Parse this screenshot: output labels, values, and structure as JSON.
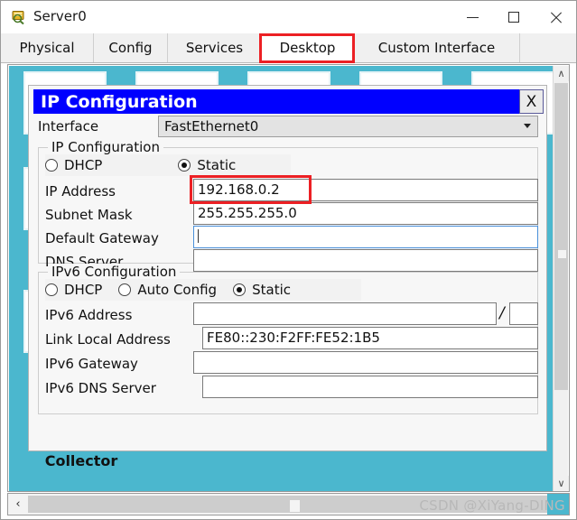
{
  "window": {
    "title": "Server0",
    "icon": "server-magnifier-icon",
    "minimize_label": "–",
    "maximize_label": "□",
    "close_label": "✕"
  },
  "tabs": [
    {
      "label": "Physical",
      "active": false
    },
    {
      "label": "Config",
      "active": false
    },
    {
      "label": "Services",
      "active": false
    },
    {
      "label": "Desktop",
      "active": true
    },
    {
      "label": "Custom Interface",
      "active": false
    }
  ],
  "annotations": {
    "color": "#ec2024",
    "desktop_tab_highlight": "Desktop",
    "ip_address_highlight": "192.168.0.2"
  },
  "desktop": {
    "background_color": "#4bb7ce",
    "partial_caption": "Collector",
    "tiles": [
      {
        "art": "monitor-tilt"
      },
      {
        "art": "monitor-tilt"
      },
      {
        "art": "monitor-flat"
      },
      {
        "art": "monitor-dark"
      },
      {
        "art": "globe"
      }
    ]
  },
  "dialog": {
    "title": "IP Configuration",
    "close_label": "X",
    "interface": {
      "label": "Interface",
      "value": "FastEthernet0"
    },
    "ipv4": {
      "group_title": "IP Configuration",
      "modes": [
        {
          "label": "DHCP",
          "selected": false
        },
        {
          "label": "Static",
          "selected": true
        }
      ],
      "fields": [
        {
          "label": "IP Address",
          "value": "192.168.0.2",
          "focused": false,
          "highlighted": true
        },
        {
          "label": "Subnet Mask",
          "value": "255.255.255.0",
          "focused": false,
          "highlighted": false
        },
        {
          "label": "Default Gateway",
          "value": "",
          "focused": true,
          "highlighted": false
        },
        {
          "label": "DNS Server",
          "value": "",
          "focused": false,
          "highlighted": false
        }
      ]
    },
    "ipv6": {
      "group_title": "IPv6 Configuration",
      "modes": [
        {
          "label": "DHCP",
          "selected": false
        },
        {
          "label": "Auto Config",
          "selected": false
        },
        {
          "label": "Static",
          "selected": true
        }
      ],
      "prefix_separator": "/",
      "prefix_value": "",
      "fields": [
        {
          "label": "IPv6 Address",
          "value": ""
        },
        {
          "label": "Link Local Address",
          "value": "FE80::230:F2FF:FE52:1B5"
        },
        {
          "label": "IPv6 Gateway",
          "value": ""
        },
        {
          "label": "IPv6 DNS Server",
          "value": ""
        }
      ]
    }
  },
  "scrollbars": {
    "vertical_up": "∧",
    "vertical_down": "∨",
    "horizontal_left": "‹"
  },
  "watermark": "CSDN @XiYang-DING"
}
